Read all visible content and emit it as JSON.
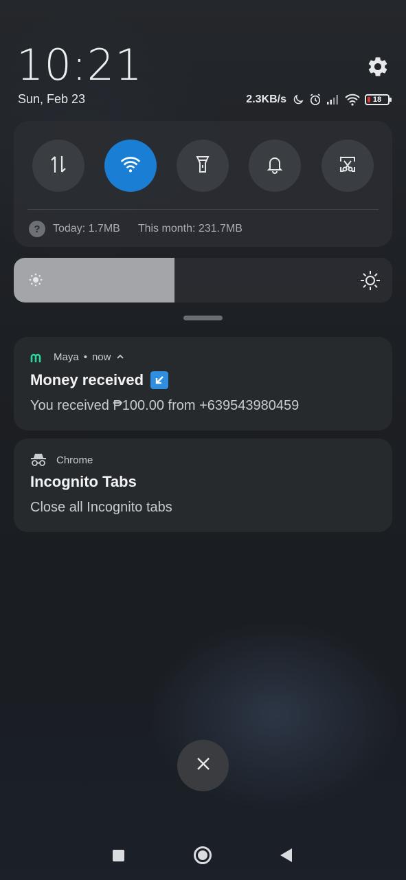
{
  "clock": {
    "time": "10:21",
    "date": "Sun, Feb 23"
  },
  "status_bar": {
    "network_speed": "2.3KB/s",
    "icons": [
      "moon-icon",
      "alarm-icon",
      "signal-icon",
      "wifi-icon",
      "battery-icon"
    ],
    "battery_level": "18",
    "battery_color": "#e53935"
  },
  "quick_settings": {
    "toggles": [
      {
        "name": "mobile-data",
        "icon": "data-arrows-icon",
        "active": false
      },
      {
        "name": "wifi",
        "icon": "wifi-icon",
        "active": true
      },
      {
        "name": "flashlight",
        "icon": "flashlight-icon",
        "active": false
      },
      {
        "name": "sound",
        "icon": "bell-icon",
        "active": false
      },
      {
        "name": "screenshot",
        "icon": "scissors-icon",
        "active": false
      }
    ],
    "accent_color": "#1a7fd4",
    "data_usage": {
      "help_glyph": "?",
      "today": "Today: 1.7MB",
      "month": "This month: 231.7MB"
    }
  },
  "brightness": {
    "level": 0.425
  },
  "notifications": [
    {
      "app": "Maya",
      "meta": "now",
      "app_icon": "maya-logo-icon",
      "app_color": "#2bd99f",
      "title": "Money received",
      "title_emoji": "↙",
      "body": "You received ₱100.00 from +639543980459"
    },
    {
      "app": "Chrome",
      "app_icon": "incognito-icon",
      "title": "Incognito Tabs",
      "body": "Close all Incognito tabs"
    }
  ],
  "clear_all": {
    "icon": "close-icon"
  },
  "nav_bar": {
    "icons": [
      "recents-icon",
      "home-icon",
      "back-icon"
    ]
  }
}
